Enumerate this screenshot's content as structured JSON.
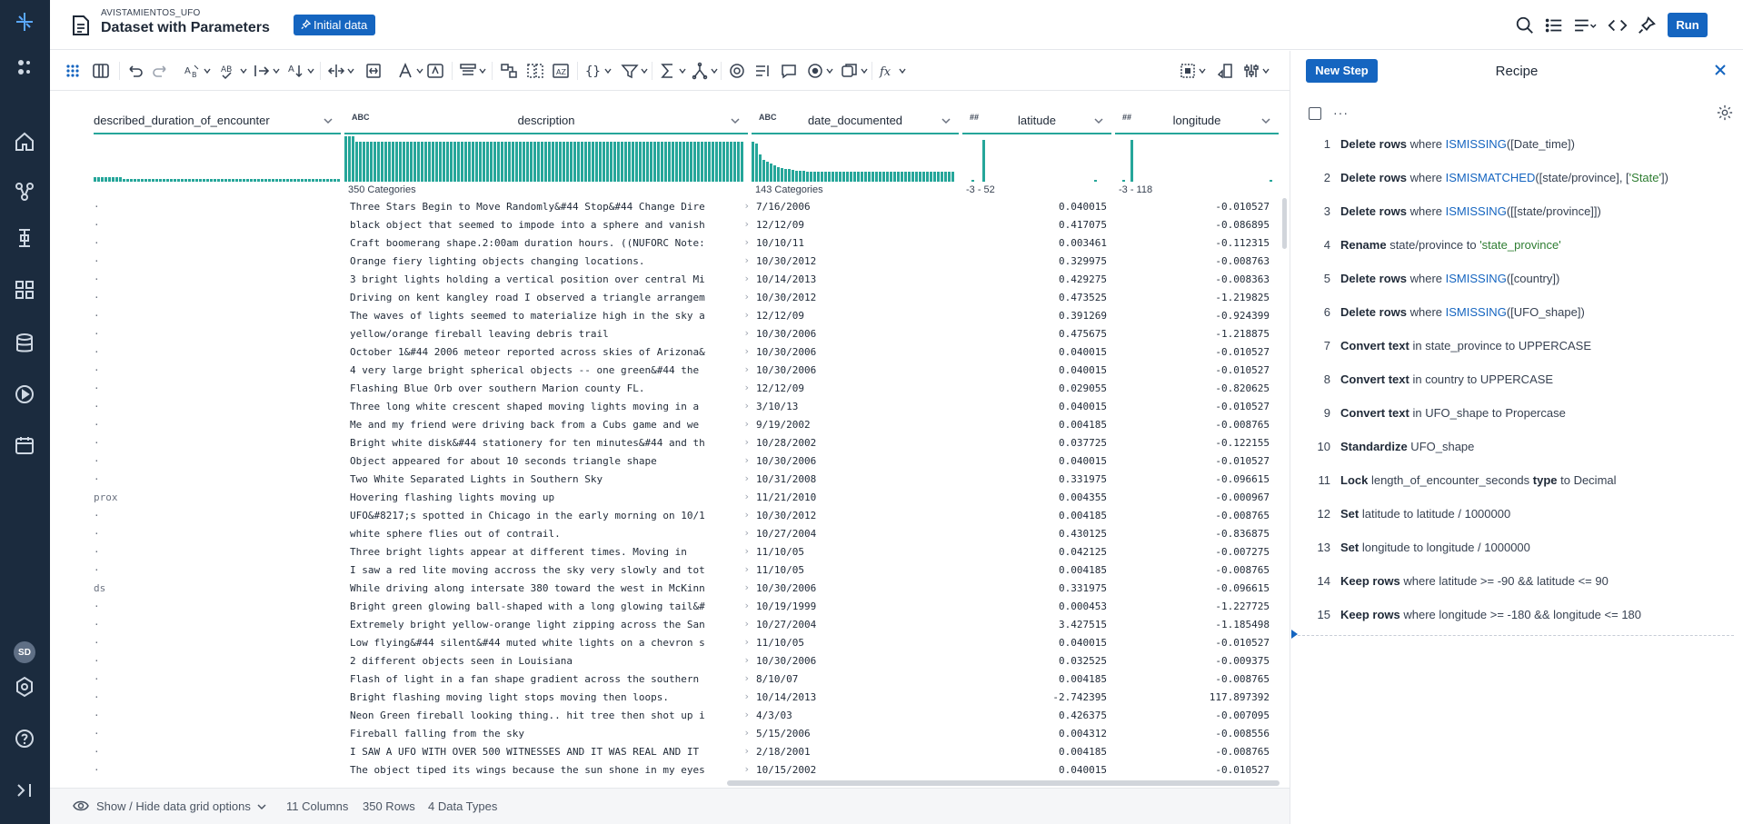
{
  "header": {
    "breadcrumb": "AVISTAMIENTOS_UFO",
    "title": "Dataset with Parameters",
    "initial_data_label": "Initial data",
    "run_label": "Run"
  },
  "columns": [
    {
      "name": "described_duration_of_encounter",
      "type": "",
      "categories_label": ""
    },
    {
      "name": "description",
      "type": "ABC",
      "categories_label": "350 Categories"
    },
    {
      "name": "date_documented",
      "type": "ABC",
      "categories_label": "143 Categories"
    },
    {
      "name": "latitude",
      "type": "##",
      "categories_label": "-3 - 52"
    },
    {
      "name": "longitude",
      "type": "##",
      "categories_label": "-3 - 118"
    }
  ],
  "rows": [
    {
      "dur": "·",
      "desc": "Three Stars Begin to Move Randomly&#44 Stop&#44 Change Dire",
      "date": "7/16/2006",
      "lat": "0.040015",
      "lon": "-0.010527"
    },
    {
      "dur": "·",
      "desc": "black object that seemed to impode into a sphere and vanish",
      "date": "12/12/09",
      "lat": "0.417075",
      "lon": "-0.086895"
    },
    {
      "dur": "·",
      "desc": "Craft boomerang shape.2:00am duration hours. ((NUFORC Note:",
      "date": "10/10/11",
      "lat": "0.003461",
      "lon": "-0.112315"
    },
    {
      "dur": "·",
      "desc": "Orange fiery lighting objects changing locations.",
      "date": "10/30/2012",
      "lat": "0.329975",
      "lon": "-0.008763"
    },
    {
      "dur": "·",
      "desc": "3 bright lights holding a vertical position over central Mi",
      "date": "10/14/2013",
      "lat": "0.429275",
      "lon": "-0.008363"
    },
    {
      "dur": "·",
      "desc": "Driving on kent kangley road I observed a triangle arrangem",
      "date": "10/30/2012",
      "lat": "0.473525",
      "lon": "-1.219825"
    },
    {
      "dur": "·",
      "desc": "The waves of lights seemed to materialize high in the sky a",
      "date": "12/12/09",
      "lat": "0.391269",
      "lon": "-0.924399"
    },
    {
      "dur": "·",
      "desc": "yellow/orange fireball leaving debris trail",
      "date": "10/30/2006",
      "lat": "0.475675",
      "lon": "-1.218875"
    },
    {
      "dur": "·",
      "desc": "October 1&#44 2006 meteor reported across skies of Arizona&",
      "date": "10/30/2006",
      "lat": "0.040015",
      "lon": "-0.010527"
    },
    {
      "dur": "·",
      "desc": "4 very large bright spherical objects -- one green&#44 the",
      "date": "10/30/2006",
      "lat": "0.040015",
      "lon": "-0.010527"
    },
    {
      "dur": "·",
      "desc": "Flashing Blue Orb over southern Marion county FL.",
      "date": "12/12/09",
      "lat": "0.029055",
      "lon": "-0.820625"
    },
    {
      "dur": "·",
      "desc": "Three long white crescent shaped moving lights moving in a",
      "date": "3/10/13",
      "lat": "0.040015",
      "lon": "-0.010527"
    },
    {
      "dur": "·",
      "desc": "Me and my friend were driving back from a Cubs game and we",
      "date": "9/19/2002",
      "lat": "0.004185",
      "lon": "-0.008765"
    },
    {
      "dur": "·",
      "desc": "Bright white disk&#44 stationery for ten minutes&#44 and th",
      "date": "10/28/2002",
      "lat": "0.037725",
      "lon": "-0.122155"
    },
    {
      "dur": "·",
      "desc": "Object appeared for about 10 seconds triangle shape",
      "date": "10/30/2006",
      "lat": "0.040015",
      "lon": "-0.010527"
    },
    {
      "dur": "·",
      "desc": "Two White Separated Lights in Southern Sky",
      "date": "10/31/2008",
      "lat": "0.331975",
      "lon": "-0.096615"
    },
    {
      "dur": "prox",
      "desc": "Hovering flashing lights moving up",
      "date": "11/21/2010",
      "lat": "0.004355",
      "lon": "-0.000967"
    },
    {
      "dur": "·",
      "desc": "UFO&#8217;s spotted in Chicago in the early morning on 10/1",
      "date": "10/30/2012",
      "lat": "0.004185",
      "lon": "-0.008765"
    },
    {
      "dur": "·",
      "desc": "white sphere flies out of contrail.",
      "date": "10/27/2004",
      "lat": "0.430125",
      "lon": "-0.836875"
    },
    {
      "dur": "·",
      "desc": "Three bright lights appear at different times.  Moving in",
      "date": "11/10/05",
      "lat": "0.042125",
      "lon": "-0.007275"
    },
    {
      "dur": "·",
      "desc": "I saw a red lite moving accross the sky very slowly and tot",
      "date": "11/10/05",
      "lat": "0.004185",
      "lon": "-0.008765"
    },
    {
      "dur": "ds",
      "desc": "While driving along intersate 380 toward the west in McKinn",
      "date": "10/30/2006",
      "lat": "0.331975",
      "lon": "-0.096615"
    },
    {
      "dur": "·",
      "desc": "Bright green glowing ball-shaped with a long glowing tail&#",
      "date": "10/19/1999",
      "lat": "0.000453",
      "lon": "-1.227725"
    },
    {
      "dur": "·",
      "desc": "Extremely bright yellow-orange light zipping across the San",
      "date": "10/27/2004",
      "lat": "3.427515",
      "lon": "-1.185498"
    },
    {
      "dur": "·",
      "desc": "Low flying&#44 silent&#44 muted white lights on a chevron s",
      "date": "11/10/05",
      "lat": "0.040015",
      "lon": "-0.010527"
    },
    {
      "dur": "·",
      "desc": "2 different objects seen in Louisiana",
      "date": "10/30/2006",
      "lat": "0.032525",
      "lon": "-0.009375"
    },
    {
      "dur": "·",
      "desc": "Flash of light in a fan shape gradient across the southern",
      "date": "8/10/07",
      "lat": "0.004185",
      "lon": "-0.008765"
    },
    {
      "dur": "·",
      "desc": "Bright flashing moving light stops moving then loops.",
      "date": "10/14/2013",
      "lat": "-2.742395",
      "lon": "117.897392"
    },
    {
      "dur": "·",
      "desc": "Neon Green fireball looking thing.. hit tree then shot up i",
      "date": "4/3/03",
      "lat": "0.426375",
      "lon": "-0.007095"
    },
    {
      "dur": "·",
      "desc": "Fireball falling from the sky",
      "date": "5/15/2006",
      "lat": "0.004312",
      "lon": "-0.008556"
    },
    {
      "dur": "·",
      "desc": "I SAW A UFO WITH OVER 500 WITNESSES AND IT WAS REAL AND IT",
      "date": "2/18/2001",
      "lat": "0.004185",
      "lon": "-0.008765"
    },
    {
      "dur": "·",
      "desc": "The object tiped its wings because the sun shone in my eyes",
      "date": "10/15/2002",
      "lat": "0.040015",
      "lon": "-0.010527"
    }
  ],
  "footer": {
    "grid_options": "Show / Hide data grid options",
    "columns": "11 Columns",
    "rows": "350 Rows",
    "types": "4 Data Types"
  },
  "recipe": {
    "new_step_label": "New Step",
    "title": "Recipe",
    "more": "···",
    "steps": [
      {
        "n": "1",
        "parts": [
          [
            "b",
            "Delete rows"
          ],
          [
            "t",
            " where "
          ],
          [
            "fn",
            "ISMISSING"
          ],
          [
            "t",
            "([Date_time])"
          ]
        ]
      },
      {
        "n": "2",
        "parts": [
          [
            "b",
            "Delete rows"
          ],
          [
            "t",
            " where "
          ],
          [
            "fn",
            "ISMISMATCHED"
          ],
          [
            "t",
            "([state/province], ["
          ],
          [
            "str",
            "'State'"
          ],
          [
            "t",
            "])"
          ]
        ]
      },
      {
        "n": "3",
        "parts": [
          [
            "b",
            "Delete rows"
          ],
          [
            "t",
            " where "
          ],
          [
            "fn",
            "ISMISSING"
          ],
          [
            "t",
            "([[state/province]])"
          ]
        ]
      },
      {
        "n": "4",
        "parts": [
          [
            "b",
            "Rename"
          ],
          [
            "t",
            " state/province to "
          ],
          [
            "str",
            "'state_province'"
          ]
        ]
      },
      {
        "n": "5",
        "parts": [
          [
            "b",
            "Delete rows"
          ],
          [
            "t",
            " where "
          ],
          [
            "fn",
            "ISMISSING"
          ],
          [
            "t",
            "([country])"
          ]
        ]
      },
      {
        "n": "6",
        "parts": [
          [
            "b",
            "Delete rows"
          ],
          [
            "t",
            " where "
          ],
          [
            "fn",
            "ISMISSING"
          ],
          [
            "t",
            "([UFO_shape])"
          ]
        ]
      },
      {
        "n": "7",
        "parts": [
          [
            "b",
            "Convert text"
          ],
          [
            "t",
            " in state_province to UPPERCASE"
          ]
        ]
      },
      {
        "n": "8",
        "parts": [
          [
            "b",
            "Convert text"
          ],
          [
            "t",
            " in country to UPPERCASE"
          ]
        ]
      },
      {
        "n": "9",
        "parts": [
          [
            "b",
            "Convert text"
          ],
          [
            "t",
            " in UFO_shape to Propercase"
          ]
        ]
      },
      {
        "n": "10",
        "parts": [
          [
            "b",
            "Standardize"
          ],
          [
            "t",
            " UFO_shape"
          ]
        ]
      },
      {
        "n": "11",
        "parts": [
          [
            "b",
            "Lock"
          ],
          [
            "t",
            " length_of_encounter_seconds "
          ],
          [
            "b",
            "type"
          ],
          [
            "t",
            " to Decimal"
          ]
        ]
      },
      {
        "n": "12",
        "parts": [
          [
            "b",
            "Set"
          ],
          [
            "t",
            " latitude to latitude / 1000000"
          ]
        ]
      },
      {
        "n": "13",
        "parts": [
          [
            "b",
            "Set"
          ],
          [
            "t",
            " longitude to longitude / 1000000"
          ]
        ]
      },
      {
        "n": "14",
        "parts": [
          [
            "b",
            "Keep rows"
          ],
          [
            "t",
            " where latitude >= -90 && latitude <= 90"
          ]
        ]
      },
      {
        "n": "15",
        "parts": [
          [
            "b",
            "Keep rows"
          ],
          [
            "t",
            " where longitude >= -180 && longitude <= 180"
          ]
        ]
      }
    ]
  },
  "colors": {
    "brand": "#1565c0",
    "teal": "#26a69a",
    "nav": "#1b2b3e"
  },
  "icons": {
    "left_nav": [
      "logo-icon",
      "flows-icon",
      "home-icon",
      "flow-icon",
      "plans-icon",
      "library-icon",
      "datasets-icon",
      "jobs-icon",
      "schedule-icon",
      "avatar",
      "settings-icon",
      "help-icon",
      "collapse-icon"
    ],
    "header": [
      "search-icon",
      "list-icon",
      "recipe-icon",
      "code-icon",
      "pin-icon"
    ]
  }
}
